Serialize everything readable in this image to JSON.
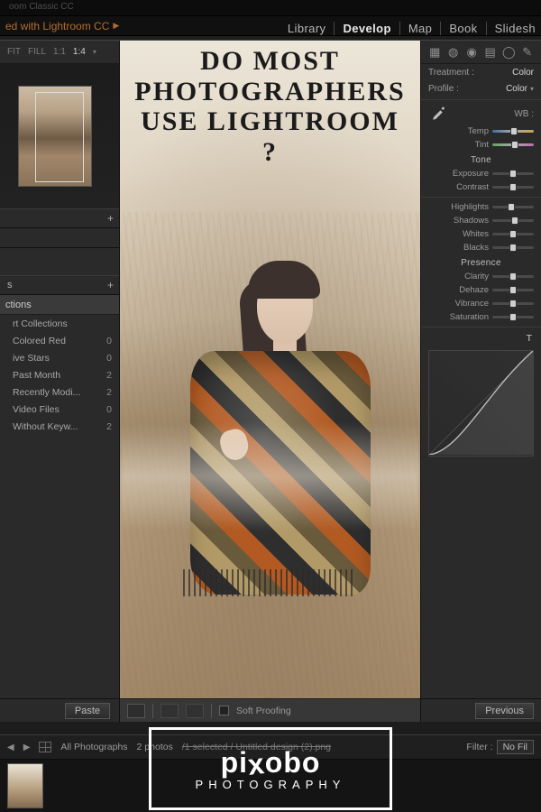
{
  "app": {
    "title_suffix": "oom Classic CC",
    "subtitle_fragment": "ed with Lightroom CC",
    "modules": [
      "Library",
      "Develop",
      "Map",
      "Book",
      "Slidesh"
    ],
    "active_module": "Develop"
  },
  "left": {
    "zoom_levels": {
      "fit": "FIT",
      "fill": "FILL",
      "one_one": "1:1",
      "ratio": "1:4",
      "selected": "1:4"
    },
    "panel_expand_1": "+",
    "panel_expand_2": "+",
    "collections_header_fragment": "s",
    "smart_collections_label": "ctions",
    "smart_collections": [
      {
        "label": "rt Collections",
        "count": ""
      },
      {
        "label": "Colored Red",
        "count": "0"
      },
      {
        "label": "ive Stars",
        "count": "0"
      },
      {
        "label": "Past Month",
        "count": "2"
      },
      {
        "label": "Recently Modi...",
        "count": "2"
      },
      {
        "label": "Video Files",
        "count": "0"
      },
      {
        "label": "Without Keyw...",
        "count": "2"
      }
    ],
    "paste_button": "Paste"
  },
  "center": {
    "headline": {
      "line1": "DO MOST",
      "line2": "PHOTOGRAPHERS",
      "line3": "USE LIGHTROOM ?"
    },
    "toolbar": {
      "soft_proofing": "Soft Proofing",
      "soft_proofing_checked": false
    }
  },
  "right": {
    "treatment": {
      "label": "Treatment :",
      "value": "Color"
    },
    "profile": {
      "label": "Profile :",
      "value": "Color"
    },
    "wb": {
      "label": "WB :"
    },
    "sliders": {
      "temp": {
        "label": "Temp",
        "pos": 0.52
      },
      "tint": {
        "label": "Tint",
        "pos": 0.55
      },
      "exposure": {
        "label": "Exposure",
        "pos": 0.5
      },
      "contrast": {
        "label": "Contrast",
        "pos": 0.5
      },
      "highlights": {
        "label": "Highlights",
        "pos": 0.45
      },
      "shadows": {
        "label": "Shadows",
        "pos": 0.55
      },
      "whites": {
        "label": "Whites",
        "pos": 0.5
      },
      "blacks": {
        "label": "Blacks",
        "pos": 0.5
      },
      "clarity": {
        "label": "Clarity",
        "pos": 0.5
      },
      "dehaze": {
        "label": "Dehaze",
        "pos": 0.5
      },
      "vibrance": {
        "label": "Vibrance",
        "pos": 0.5
      },
      "saturation": {
        "label": "Saturation",
        "pos": 0.5
      }
    },
    "sections": {
      "tone": "Tone",
      "presence": "Presence",
      "tone_curve_fragment": "T"
    },
    "previous_button": "Previous"
  },
  "filmstrip": {
    "source": "All Photographs",
    "count_text": "2 photos",
    "selection_text": "/1 selected / Untitled design (2).png",
    "filter_label": "Filter :",
    "filter_value": "No Fil"
  },
  "overlay": {
    "brand": "pixobo",
    "tag": "PHOTOGRAPHY"
  },
  "colors": {
    "accent_orange": "#b36f2f",
    "panel_bg": "#2a2a2a"
  }
}
